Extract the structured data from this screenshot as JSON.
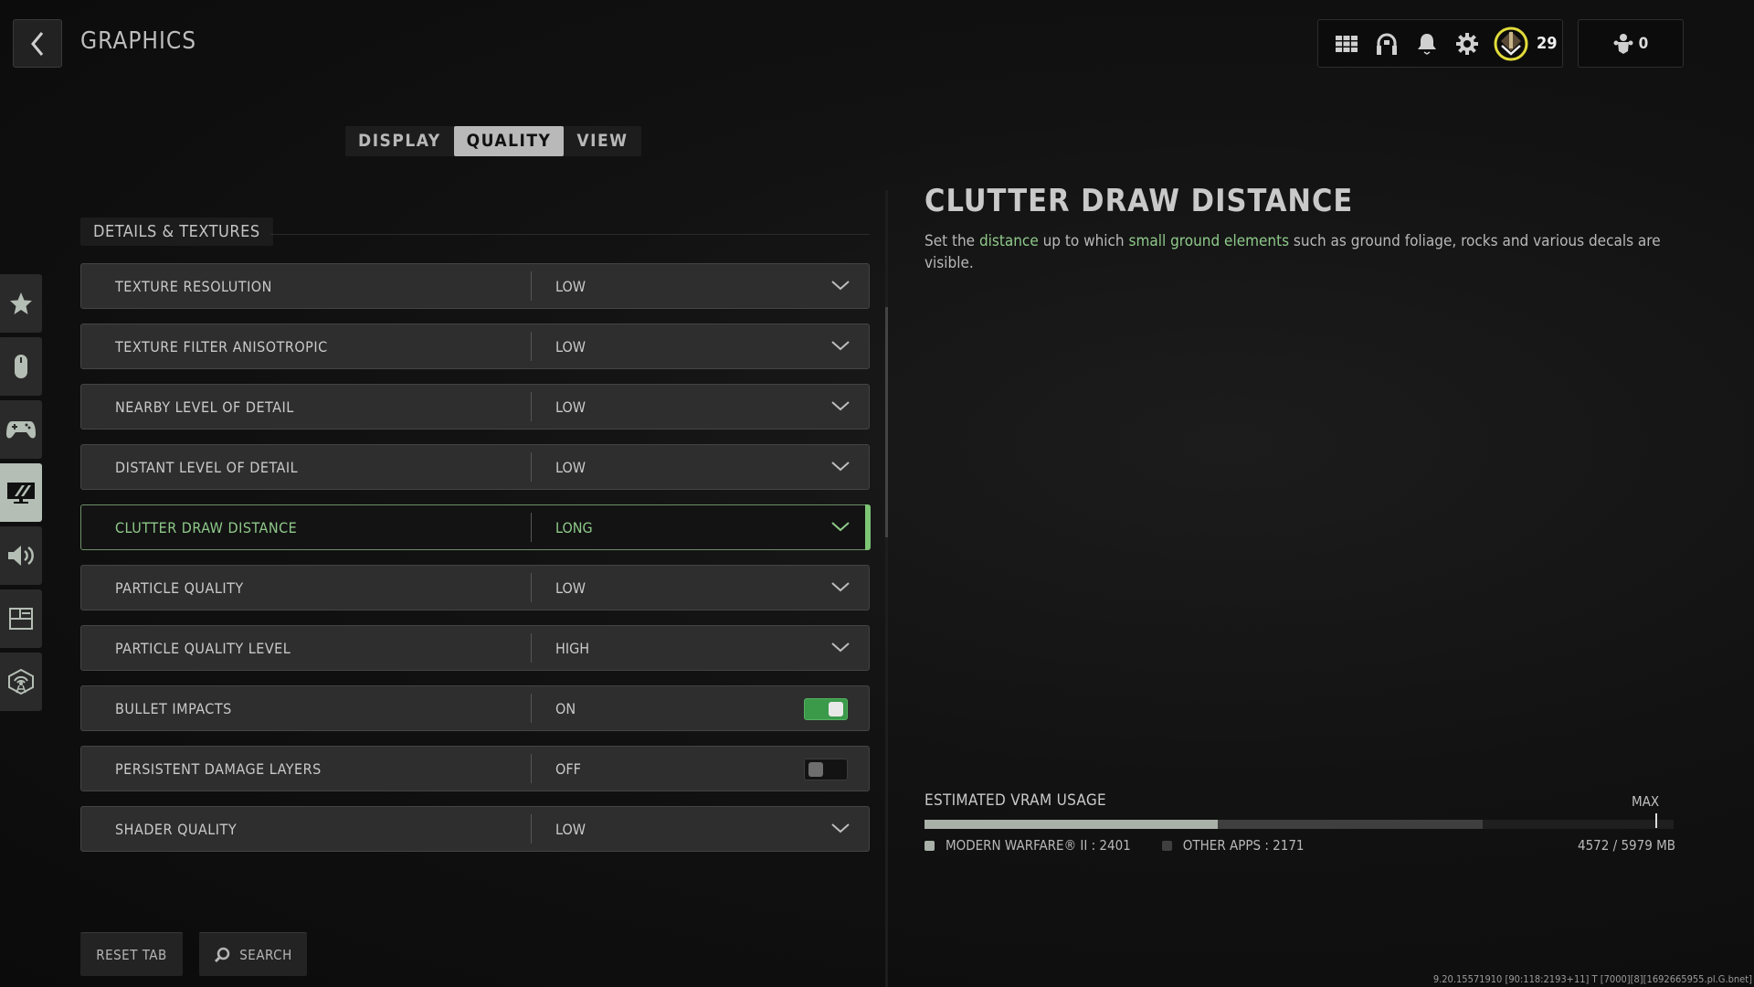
{
  "header": {
    "back_label": "Back",
    "title": "GRAPHICS"
  },
  "topbar": {
    "icons": [
      "grid-menu-icon",
      "headset-icon",
      "bell-icon",
      "gear-icon",
      "rank-badge-icon"
    ],
    "level": "29",
    "party_count": "0"
  },
  "tabs": [
    {
      "label": "DISPLAY",
      "active": false
    },
    {
      "label": "QUALITY",
      "active": true
    },
    {
      "label": "VIEW",
      "active": false
    }
  ],
  "sidebar": {
    "items": [
      {
        "name": "star-icon",
        "active": false
      },
      {
        "name": "mouse-icon",
        "active": false
      },
      {
        "name": "controller-icon",
        "active": false
      },
      {
        "name": "graphics-monitor-icon",
        "active": true
      },
      {
        "name": "speaker-icon",
        "active": false
      },
      {
        "name": "interface-icon",
        "active": false
      },
      {
        "name": "network-icon",
        "active": false
      }
    ]
  },
  "section": {
    "title": "DETAILS & TEXTURES"
  },
  "settings": [
    {
      "label": "TEXTURE RESOLUTION",
      "value": "LOW",
      "type": "dropdown",
      "selected": false
    },
    {
      "label": "TEXTURE FILTER ANISOTROPIC",
      "value": "LOW",
      "type": "dropdown",
      "selected": false
    },
    {
      "label": "NEARBY LEVEL OF DETAIL",
      "value": "LOW",
      "type": "dropdown",
      "selected": false
    },
    {
      "label": "DISTANT LEVEL OF DETAIL",
      "value": "LOW",
      "type": "dropdown",
      "selected": false
    },
    {
      "label": "CLUTTER DRAW DISTANCE",
      "value": "LONG",
      "type": "dropdown",
      "selected": true
    },
    {
      "label": "PARTICLE QUALITY",
      "value": "LOW",
      "type": "dropdown",
      "selected": false
    },
    {
      "label": "PARTICLE QUALITY LEVEL",
      "value": "HIGH",
      "type": "dropdown",
      "selected": false
    },
    {
      "label": "BULLET IMPACTS",
      "value": "ON",
      "type": "toggle",
      "on": true,
      "selected": false
    },
    {
      "label": "PERSISTENT DAMAGE LAYERS",
      "value": "OFF",
      "type": "toggle",
      "on": false,
      "selected": false
    },
    {
      "label": "SHADER QUALITY",
      "value": "LOW",
      "type": "dropdown",
      "selected": false
    }
  ],
  "detail": {
    "title": "CLUTTER DRAW DISTANCE",
    "desc_parts": [
      {
        "text": "Set the ",
        "hl": false
      },
      {
        "text": "distance",
        "hl": true
      },
      {
        "text": " up to which ",
        "hl": false
      },
      {
        "text": "small ground elements",
        "hl": true
      },
      {
        "text": " such as ground foliage, rocks and various decals are visible.",
        "hl": false
      }
    ]
  },
  "vram": {
    "title": "ESTIMATED VRAM USAGE",
    "max_label": "MAX",
    "game_label": "MODERN WARFARE® II : 2401",
    "other_label": "OTHER APPS : 2171",
    "total_label": "4572 / 5979 MB",
    "game_mb": 2401,
    "other_mb": 2171,
    "max_mb": 5979,
    "capacity_fraction_of_bar": 0.975
  },
  "colors": {
    "accent_green": "#7cc575",
    "highlight_text": "#8fc98a",
    "toggle_on": "#3a9a4a",
    "level_ring": "#e2dc3a"
  },
  "footer": {
    "reset_label": "RESET TAB",
    "search_label": "SEARCH",
    "build_info": "9.20.15571910 [90:118:2193+11] T [7000][8][1692665955.pl.G.bnet]"
  }
}
